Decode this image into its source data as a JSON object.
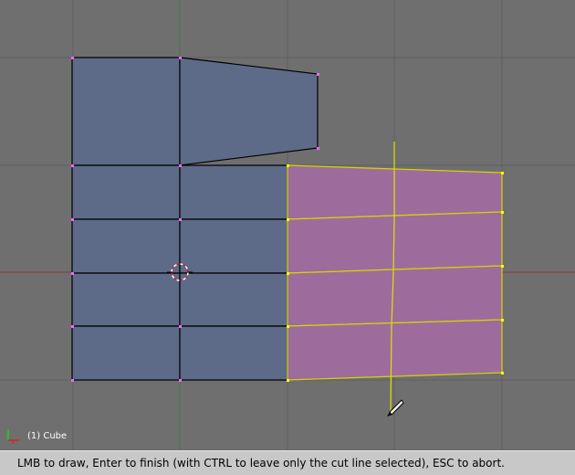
{
  "viewport": {
    "object_label": "(1) Cube",
    "colors": {
      "background": "#6f6f6f",
      "grid_line": "#5f5f5f",
      "x_axis": "#8a3a3a",
      "y_axis": "#3d7a3d",
      "face_unselected": "#5d6b88",
      "face_selected": "#9d6c9d",
      "edge_unselected": "#000000",
      "edge_selected": "#d4d400",
      "vertex_unselected": "#ff66ff",
      "vertex_selected": "#ffff00",
      "knife_line": "#e0e000"
    },
    "icons": [
      "view-axis-icon",
      "3d-cursor-icon",
      "knife-cursor-icon"
    ]
  },
  "status_bar": {
    "text": "LMB to draw, Enter to finish (with CTRL to leave only the cut line selected), ESC to abort."
  }
}
